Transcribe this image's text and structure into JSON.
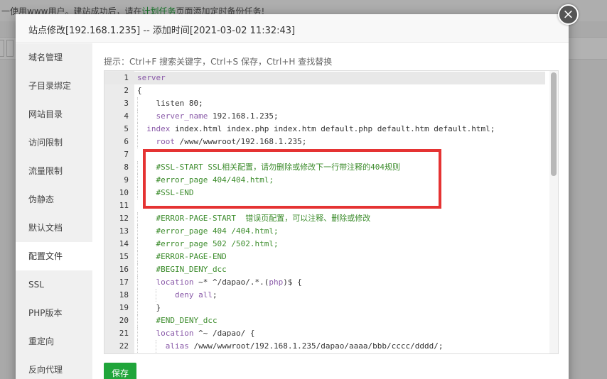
{
  "background": {
    "notice_prefix": "一使用www用户。建站成功后，请在",
    "notice_link": "计划任务",
    "notice_suffix": "页面添加定时备份任务!"
  },
  "modal": {
    "title": "站点修改[192.168.1.235] -- 添加时间[2021-03-02 11:32:43]",
    "close_icon": "close-icon"
  },
  "sidebar": {
    "items": [
      {
        "label": "域名管理"
      },
      {
        "label": "子目录绑定"
      },
      {
        "label": "网站目录"
      },
      {
        "label": "访问限制"
      },
      {
        "label": "流量限制"
      },
      {
        "label": "伪静态"
      },
      {
        "label": "默认文档"
      },
      {
        "label": "配置文件"
      },
      {
        "label": "SSL"
      },
      {
        "label": "PHP版本"
      },
      {
        "label": "重定向"
      },
      {
        "label": "反向代理"
      }
    ],
    "active_index": 7
  },
  "content": {
    "hint": "提示：Ctrl+F 搜索关键字，Ctrl+S 保存，Ctrl+H 查找替换",
    "save_label": "保存"
  },
  "editor": {
    "lines": [
      {
        "n": "1",
        "indent": 0,
        "parts": [
          [
            "kw",
            "server"
          ]
        ]
      },
      {
        "n": "2",
        "indent": 0,
        "parts": [
          [
            "tx",
            "{"
          ]
        ]
      },
      {
        "n": "3",
        "indent": 4,
        "parts": [
          [
            "tx",
            "listen 80;"
          ]
        ]
      },
      {
        "n": "4",
        "indent": 4,
        "parts": [
          [
            "kw",
            "server_name"
          ],
          [
            "tx",
            " 192.168.1.235;"
          ]
        ]
      },
      {
        "n": "5",
        "indent": 2,
        "parts": [
          [
            "kw",
            "index"
          ],
          [
            "tx",
            " index.html index.php index.htm default.php default.htm default.html;"
          ]
        ]
      },
      {
        "n": "6",
        "indent": 4,
        "parts": [
          [
            "kw",
            "root"
          ],
          [
            "tx",
            " /www/wwwroot/192.168.1.235;"
          ]
        ]
      },
      {
        "n": "7",
        "indent": 0,
        "parts": [
          [
            "tx",
            ""
          ]
        ]
      },
      {
        "n": "8",
        "indent": 4,
        "parts": [
          [
            "cm",
            "#SSL-START SSL相关配置，请勿删除或修改下一行带注释的404规则"
          ]
        ]
      },
      {
        "n": "9",
        "indent": 4,
        "parts": [
          [
            "cm",
            "#error_page 404/404.html;"
          ]
        ]
      },
      {
        "n": "10",
        "indent": 4,
        "parts": [
          [
            "cm",
            "#SSL-END"
          ]
        ]
      },
      {
        "n": "11",
        "indent": 0,
        "parts": [
          [
            "tx",
            ""
          ]
        ]
      },
      {
        "n": "12",
        "indent": 4,
        "parts": [
          [
            "cm",
            "#ERROR-PAGE-START  错误页配置，可以注释、删除或修改"
          ]
        ]
      },
      {
        "n": "13",
        "indent": 4,
        "parts": [
          [
            "cm",
            "#error_page 404 /404.html;"
          ]
        ]
      },
      {
        "n": "14",
        "indent": 4,
        "parts": [
          [
            "cm",
            "#error_page 502 /502.html;"
          ]
        ]
      },
      {
        "n": "15",
        "indent": 4,
        "parts": [
          [
            "cm",
            "#ERROR-PAGE-END"
          ]
        ]
      },
      {
        "n": "16",
        "indent": 4,
        "parts": [
          [
            "cm",
            "#BEGIN_DENY_dcc"
          ]
        ]
      },
      {
        "n": "17",
        "indent": 4,
        "parts": [
          [
            "kw",
            "location"
          ],
          [
            "tx",
            " ~* ^/dapao/.*.("
          ],
          [
            "kw",
            "php"
          ],
          [
            "tx",
            ")$ {"
          ]
        ]
      },
      {
        "n": "18",
        "indent": 8,
        "parts": [
          [
            "kw",
            "deny"
          ],
          [
            "tx",
            " "
          ],
          [
            "kw",
            "all"
          ],
          [
            "tx",
            ";"
          ]
        ]
      },
      {
        "n": "19",
        "indent": 4,
        "parts": [
          [
            "tx",
            "}"
          ]
        ]
      },
      {
        "n": "20",
        "indent": 4,
        "parts": [
          [
            "cm",
            "#END_DENY_dcc"
          ]
        ]
      },
      {
        "n": "21",
        "indent": 4,
        "parts": [
          [
            "kw",
            "location"
          ],
          [
            "tx",
            " ^~ /dapao/ {"
          ]
        ]
      },
      {
        "n": "22",
        "indent": 6,
        "parts": [
          [
            "kw",
            "alias"
          ],
          [
            "tx",
            " /www/wwwroot/192.168.1.235/dapao/aaaa/bbb/cccc/dddd/;"
          ]
        ]
      }
    ]
  }
}
